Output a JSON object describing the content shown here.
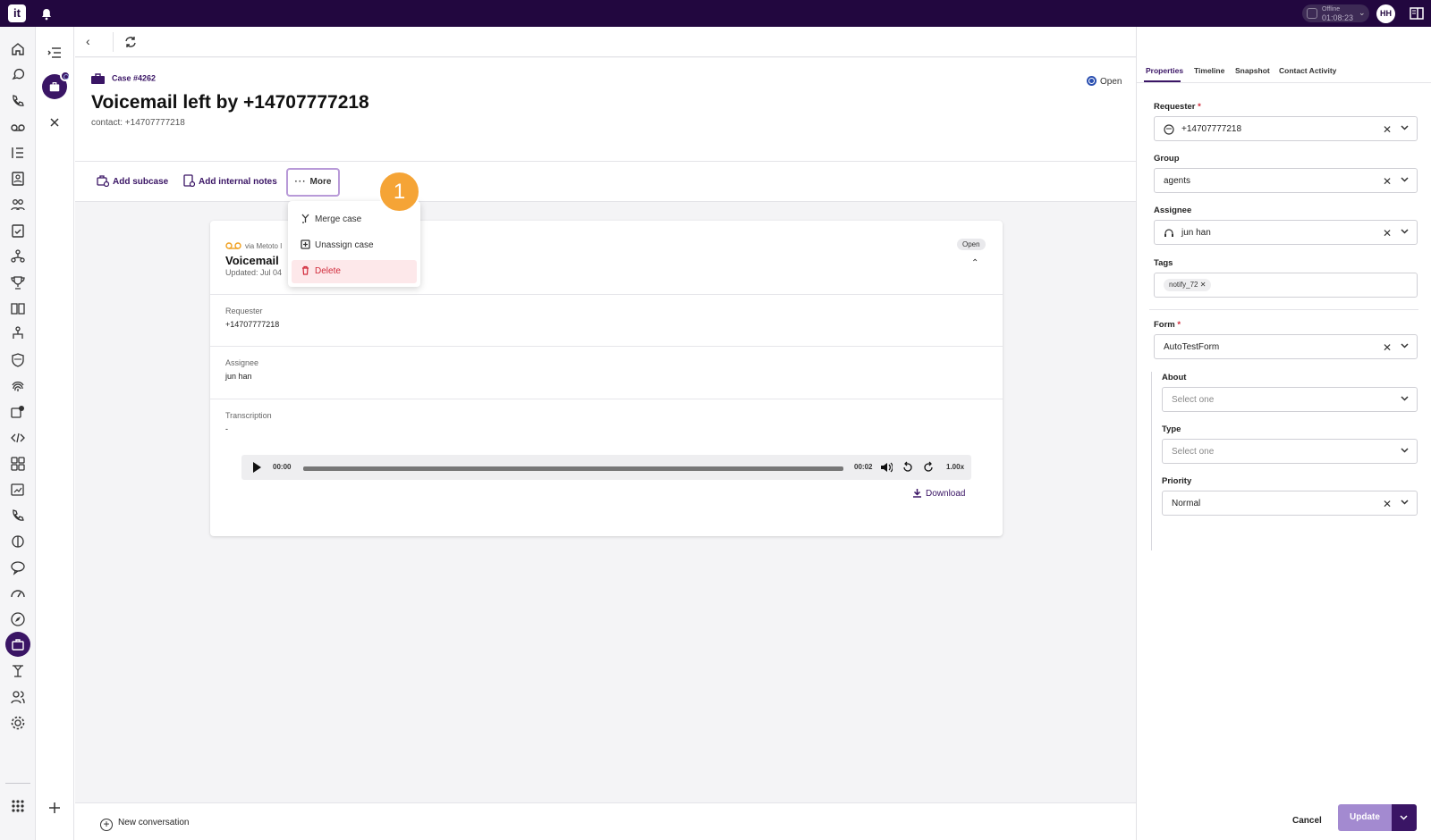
{
  "topbar": {
    "logo": "it",
    "status_line1": "Offline",
    "status_line2": "01:08:23",
    "avatar_initials": "HH"
  },
  "case": {
    "number": "Case #4262",
    "title": "Voicemail left by  +14707777218",
    "contact": "contact:  +14707777218",
    "status": "Open"
  },
  "actions": {
    "add_subcase": "Add subcase",
    "add_internal_notes": "Add internal notes",
    "more": "More"
  },
  "step_badge": "1",
  "more_menu": {
    "items": [
      "Merge case",
      "Unassign case",
      "Delete"
    ]
  },
  "voicemail_card": {
    "via": "via Metoto I",
    "title": "Voicemail",
    "updated": "Updated: Jul 04",
    "status": "Open",
    "requester_label": "Requester",
    "requester_value": "+14707777218",
    "assignee_label": "Assignee",
    "assignee_value": "jun han",
    "transcription_label": "Transcription",
    "transcription_value": "-"
  },
  "player": {
    "current_time": "00:00",
    "duration": "00:02",
    "speed": "1.00x",
    "download": "Download"
  },
  "bottombar": {
    "new_conversation": "New conversation"
  },
  "right_panel": {
    "tabs": [
      "Properties",
      "Timeline",
      "Snapshot",
      "Contact Activity"
    ],
    "requester_label": "Requester",
    "requester_value": "+14707777218",
    "group_label": "Group",
    "group_value": "agents",
    "assignee_label": "Assignee",
    "assignee_value": "jun han",
    "tags_label": "Tags",
    "tag_value": "notify_72",
    "form_label": "Form",
    "form_value": "AutoTestForm",
    "about_label": "About",
    "about_placeholder": "Select one",
    "type_label": "Type",
    "type_placeholder": "Select one",
    "priority_label": "Priority",
    "priority_value": "Normal",
    "cancel": "Cancel",
    "update": "Update"
  },
  "colors": {
    "brand": "#22073f",
    "accent": "#3a1565",
    "badge": "#f5a436",
    "danger": "#d12a3a"
  }
}
